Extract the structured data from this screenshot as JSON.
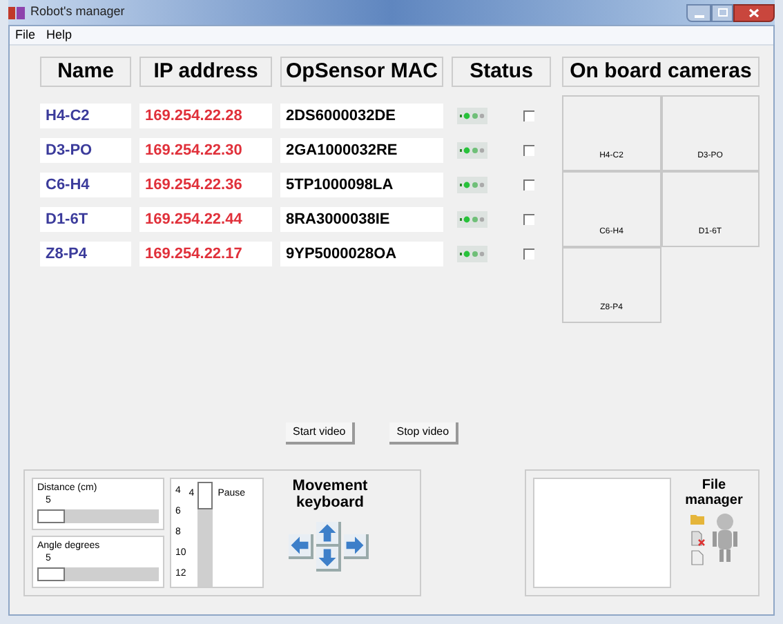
{
  "window": {
    "title": "Robot's manager"
  },
  "menu": [
    "File",
    "Help"
  ],
  "columns": [
    "Name",
    "IP address",
    "OpSensor MAC",
    "Status",
    "On board cameras"
  ],
  "robots": [
    {
      "name": "H4-C2",
      "ip": "169.254.22.28",
      "mac": "2DS6000032DE",
      "connected": true,
      "checked": false
    },
    {
      "name": "D3-PO",
      "ip": "169.254.22.30",
      "mac": "2GA1000032RE",
      "connected": true,
      "checked": false
    },
    {
      "name": "C6-H4",
      "ip": "169.254.22.36",
      "mac": "5TP1000098LA",
      "connected": true,
      "checked": false
    },
    {
      "name": "D1-6T",
      "ip": "169.254.22.44",
      "mac": "8RA3000038IE",
      "connected": true,
      "checked": false
    },
    {
      "name": "Z8-P4",
      "ip": "169.254.22.17",
      "mac": "9YP5000028OA",
      "connected": true,
      "checked": false
    }
  ],
  "cameras": [
    "H4-C2",
    "D3-PO",
    "C6-H4",
    "D1-6T",
    "Z8-P4"
  ],
  "video_buttons": [
    "Start video",
    "Stop video"
  ],
  "sliders": [
    {
      "label": "Distance (cm)",
      "reading": "5",
      "level": 0
    },
    {
      "label": "Angle degrees",
      "reading": "5",
      "level": 0
    }
  ],
  "speed": {
    "ticks": [
      "4",
      "6",
      "8",
      "10",
      "12"
    ],
    "reading": "4",
    "level": 0,
    "pause": "Pause"
  },
  "movement": {
    "title": "Movement keyboard"
  },
  "file_manager": {
    "title": "File manager"
  }
}
